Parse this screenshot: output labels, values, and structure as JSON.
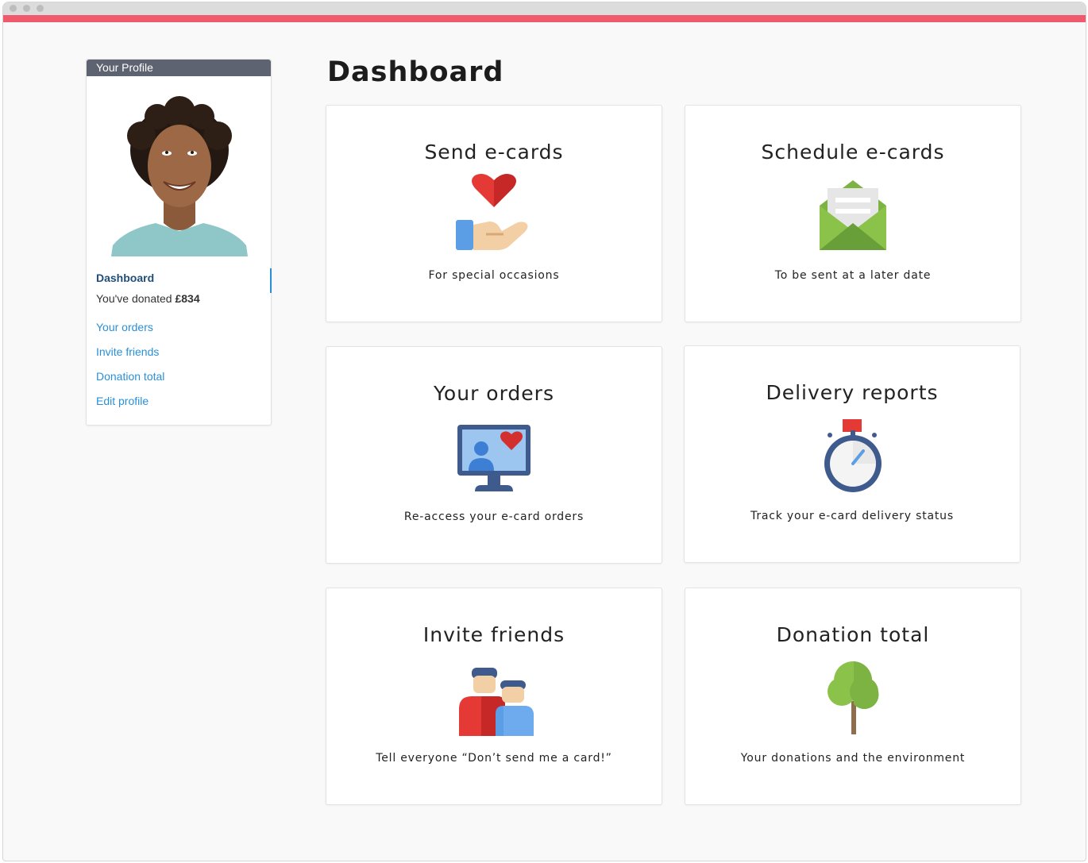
{
  "profile": {
    "header": "Your Profile",
    "nav_active": "Dashboard",
    "donated_prefix": "You've donated ",
    "donated_amount": "£834",
    "links": [
      "Your orders",
      "Invite friends",
      "Donation total",
      "Edit profile"
    ]
  },
  "dashboard": {
    "title": "Dashboard",
    "cards": [
      {
        "title": "Send e-cards",
        "subtitle": "For special occasions",
        "icon": "heart-in-hand-icon"
      },
      {
        "title": "Schedule e-cards",
        "subtitle": "To be sent at a later date",
        "icon": "open-envelope-icon"
      },
      {
        "title": "Your orders",
        "subtitle": "Re-access your e-card orders",
        "icon": "monitor-heart-icon"
      },
      {
        "title": "Delivery reports",
        "subtitle": "Track your e-card delivery status",
        "icon": "stopwatch-icon"
      },
      {
        "title": "Invite friends",
        "subtitle": "Tell everyone “Don’t send me a card!”",
        "icon": "friends-icon"
      },
      {
        "title": "Donation total",
        "subtitle": "Your donations and the environment",
        "icon": "tree-icon"
      }
    ]
  },
  "colors": {
    "accent_bar": "#ef5a6d",
    "link": "#2a8fd6",
    "profile_header": "#5d6370",
    "nav_active": "#1f4e79"
  }
}
